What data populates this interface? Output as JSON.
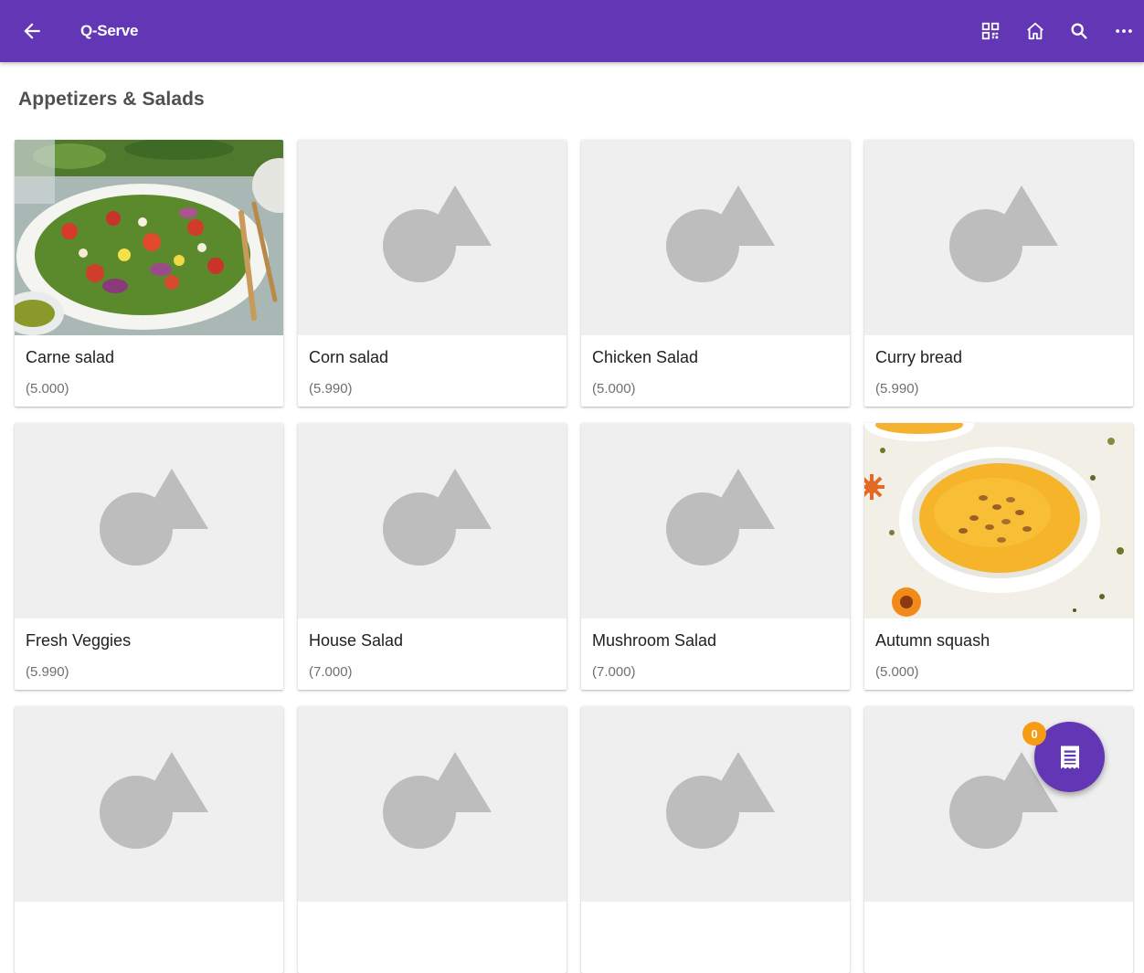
{
  "app": {
    "title": "Q-Serve",
    "accent_color": "#6236b4",
    "actions": [
      {
        "icon": "qr-code-icon"
      },
      {
        "icon": "home-icon"
      },
      {
        "icon": "search-icon"
      },
      {
        "icon": "more-icon"
      }
    ]
  },
  "section": {
    "title": "Appetizers & Salads"
  },
  "items": [
    {
      "name": "Carne salad",
      "price": "(5.000)",
      "image": "salad-photo"
    },
    {
      "name": "Corn salad",
      "price": "(5.990)",
      "image": "placeholder"
    },
    {
      "name": "Chicken Salad",
      "price": "(5.000)",
      "image": "placeholder"
    },
    {
      "name": "Curry bread",
      "price": "(5.990)",
      "image": "placeholder"
    },
    {
      "name": "Fresh Veggies",
      "price": "(5.990)",
      "image": "placeholder"
    },
    {
      "name": "House Salad",
      "price": "(7.000)",
      "image": "placeholder"
    },
    {
      "name": "Mushroom Salad",
      "price": "(7.000)",
      "image": "placeholder"
    },
    {
      "name": "Autumn squash",
      "price": "(5.000)",
      "image": "soup-photo"
    },
    {
      "name": "",
      "price": "",
      "image": "placeholder"
    },
    {
      "name": "",
      "price": "",
      "image": "placeholder"
    },
    {
      "name": "",
      "price": "",
      "image": "placeholder"
    },
    {
      "name": "",
      "price": "",
      "image": "placeholder"
    }
  ],
  "cart": {
    "count": "0",
    "icon": "receipt-icon",
    "badge_color": "#f59c14"
  }
}
